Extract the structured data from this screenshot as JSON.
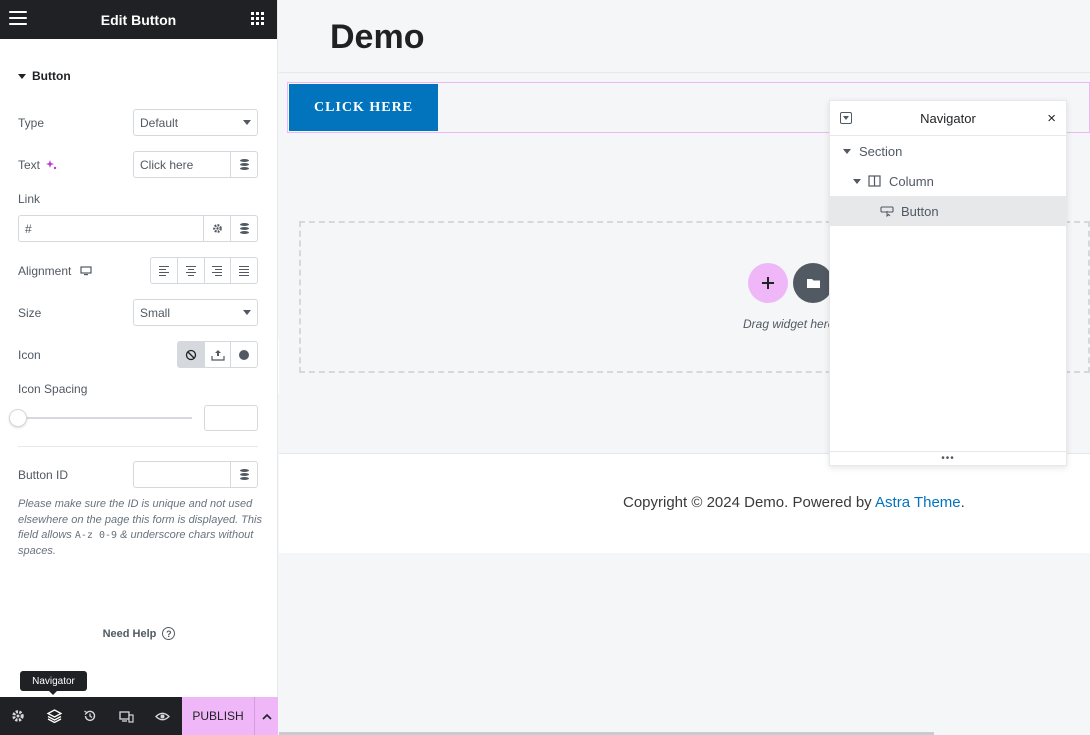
{
  "panel": {
    "title": "Edit Button",
    "section_title": "Button",
    "type_label": "Type",
    "type_value": "Default",
    "text_label": "Text",
    "text_value": "Click here",
    "link_label": "Link",
    "link_value": "#",
    "alignment_label": "Alignment",
    "size_label": "Size",
    "size_value": "Small",
    "icon_label": "Icon",
    "icon_spacing_label": "Icon Spacing",
    "button_id_label": "Button ID",
    "help_part1": "Please make sure the ID is unique and not used elsewhere on the page this form is displayed. This field allows ",
    "help_code": "A-z 0-9",
    "help_part2": " & underscore chars without spaces.",
    "need_help": "Need Help",
    "publish": "PUBLISH",
    "tooltip": "Navigator"
  },
  "preview": {
    "site_title": "Demo",
    "cta_label": "CLICK HERE",
    "drag_text": "Drag widget here",
    "copyright_prefix": "Copyright © 2024 Demo. Powered by ",
    "copyright_link": "Astra Theme",
    "copyright_suffix": "."
  },
  "navigator": {
    "title": "Navigator",
    "items": [
      {
        "label": "Section"
      },
      {
        "label": "Column"
      },
      {
        "label": "Button"
      }
    ]
  },
  "colors": {
    "accent_pink": "#f0b7f8",
    "cta_blue": "#0274be",
    "dark": "#1f2124"
  }
}
